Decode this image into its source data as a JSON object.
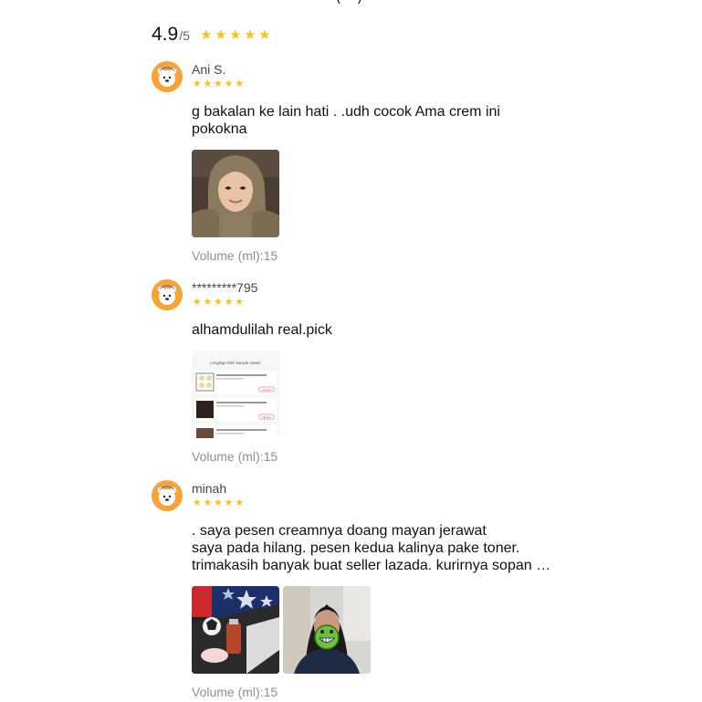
{
  "header_cut_text": "— — — — — — — — — (—)",
  "summary": {
    "rating": "4.9",
    "out_of": "/5",
    "stars": 5
  },
  "colors": {
    "star": "#f8c21a",
    "avatar_bg": "#f6a437",
    "variant_text": "#8a8f99"
  },
  "reviews": [
    {
      "name": "Ani S.",
      "stars": 5,
      "text": "g bakalan ke lain hati . .udh cocok Ama crem ini\npokokna",
      "photos": [
        "photo-selfie-hijab"
      ],
      "variant": "Volume (ml):15"
    },
    {
      "name": "*********795",
      "stars": 5,
      "text": "alhamdulilah real.pick",
      "photos": [
        "photo-app-screenshot"
      ],
      "screenshot_header": "Lengkapi lebih banyak ulasan",
      "screenshot_button": "Ulasan",
      "variant": "Volume (ml):15"
    },
    {
      "name": "minah",
      "stars": 5,
      "text": ". saya pesen creamnya doang mayan jerawat\nsaya pada hilang. pesen kedua kalinya pake toner.\ntrimakasih banyak buat seller lazada. kurirnya sopan …",
      "photos": [
        "photo-product-package",
        "photo-selfie-sticker"
      ],
      "variant": "Volume (ml):15"
    }
  ]
}
